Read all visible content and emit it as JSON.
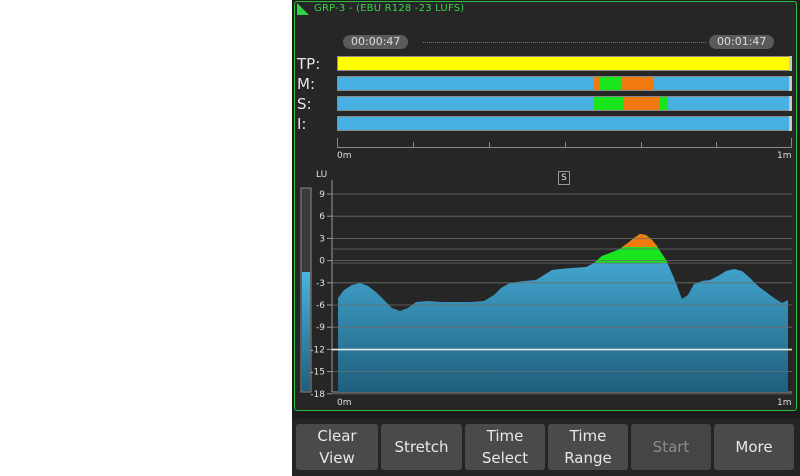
{
  "title": "GRP-3 - (EBU R128 -23 LUFS)",
  "time_start": "00:00:47",
  "time_end": "00:01:47",
  "rows": [
    {
      "label": "TP:"
    },
    {
      "label": "M:"
    },
    {
      "label": "S:"
    },
    {
      "label": "I:"
    }
  ],
  "top_axis": {
    "start": "0m",
    "end": "1m"
  },
  "graph": {
    "mode_badge": "S",
    "unit": "LU",
    "y_ticks": [
      "9",
      "6",
      "3",
      "0",
      "-3",
      "-6",
      "-9",
      "-12",
      "-15",
      "-18"
    ],
    "x_start": "0m",
    "x_end": "1m"
  },
  "buttons": [
    {
      "label": "Clear\nView",
      "enabled": true
    },
    {
      "label": "Stretch",
      "enabled": true
    },
    {
      "label": "Time\nSelect",
      "enabled": true
    },
    {
      "label": "Time\nRange",
      "enabled": true
    },
    {
      "label": "Start",
      "enabled": false
    },
    {
      "label": "More",
      "enabled": true
    }
  ],
  "colors": {
    "accent": "#2fd04a",
    "loudness_blue": "#47b2e2",
    "true_peak": "#ffff00",
    "over_green": "#18e51c",
    "over_orange": "#f07a10"
  }
}
